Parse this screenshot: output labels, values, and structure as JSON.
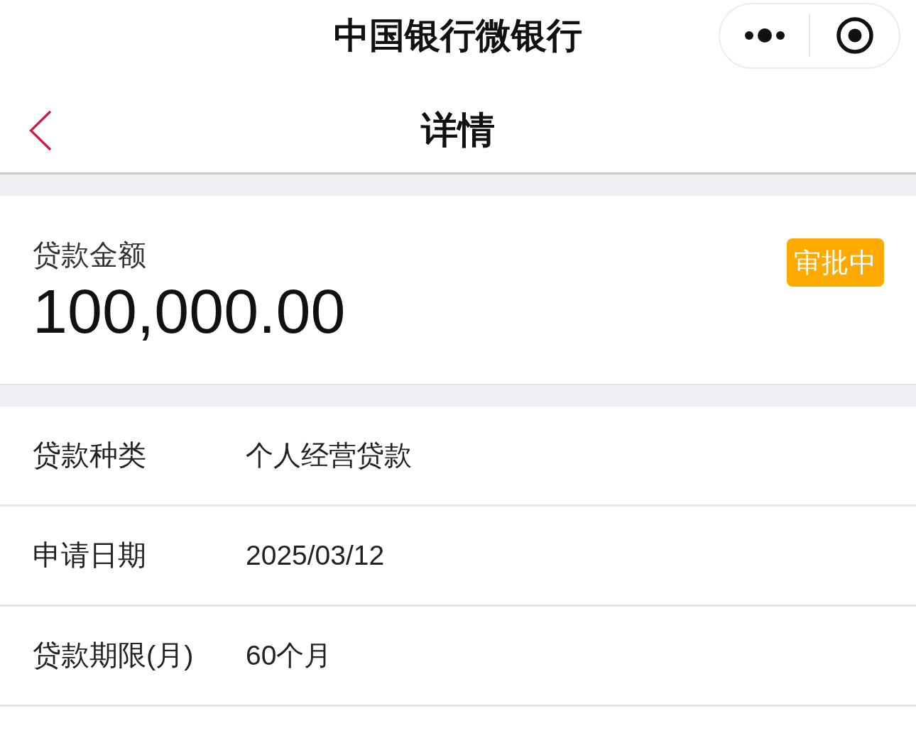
{
  "top_bar": {
    "title": "中国银行微银行"
  },
  "nav_bar": {
    "title": "详情"
  },
  "amount_card": {
    "label": "贷款金额",
    "amount": "100,000.00",
    "status": "审批中"
  },
  "details": [
    {
      "label": "贷款种类",
      "value": "个人经营贷款"
    },
    {
      "label": "申请日期",
      "value": "2025/03/12"
    },
    {
      "label": "贷款期限(月)",
      "value": "60个月"
    }
  ]
}
